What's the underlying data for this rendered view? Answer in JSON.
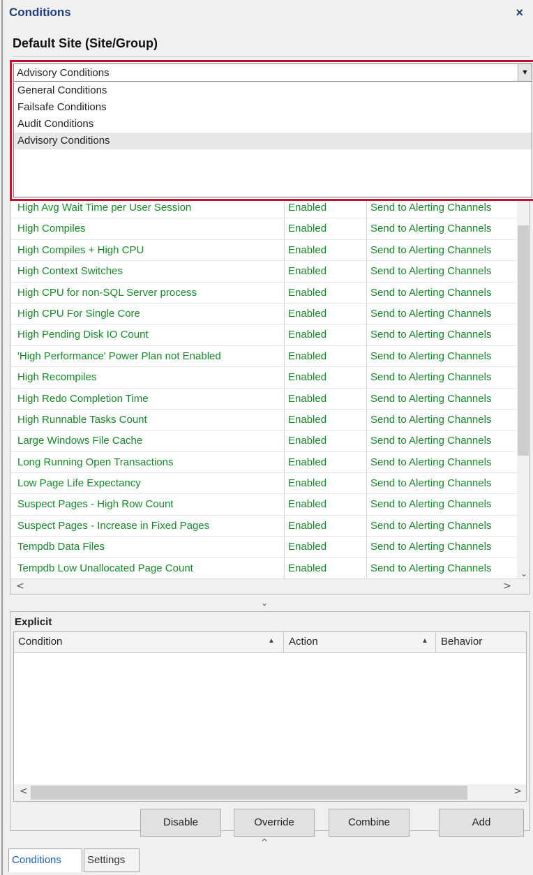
{
  "header": {
    "title": "Conditions",
    "close_glyph": "×",
    "site": "Default Site (Site/Group)"
  },
  "dropdown": {
    "selected": "Advisory Conditions",
    "arrow_glyph": "▼",
    "options": [
      "General Conditions",
      "Failsafe Conditions",
      "Audit Conditions",
      "Advisory Conditions"
    ]
  },
  "conditions": {
    "rows": [
      {
        "name": "High Avg Wait Time per User Session",
        "status": "Enabled",
        "action": "Send to Alerting Channels"
      },
      {
        "name": "High Compiles",
        "status": "Enabled",
        "action": "Send to Alerting Channels"
      },
      {
        "name": "High Compiles + High CPU",
        "status": "Enabled",
        "action": "Send to Alerting Channels"
      },
      {
        "name": "High Context Switches",
        "status": "Enabled",
        "action": "Send to Alerting Channels"
      },
      {
        "name": "High CPU for non-SQL Server process",
        "status": "Enabled",
        "action": "Send to Alerting Channels"
      },
      {
        "name": "High CPU For Single Core",
        "status": "Enabled",
        "action": "Send to Alerting Channels"
      },
      {
        "name": "High Pending Disk IO Count",
        "status": "Enabled",
        "action": "Send to Alerting Channels"
      },
      {
        "name": "'High Performance' Power Plan not Enabled",
        "status": "Enabled",
        "action": "Send to Alerting Channels"
      },
      {
        "name": "High Recompiles",
        "status": "Enabled",
        "action": "Send to Alerting Channels"
      },
      {
        "name": "High Redo Completion Time",
        "status": "Enabled",
        "action": "Send to Alerting Channels"
      },
      {
        "name": "High Runnable Tasks Count",
        "status": "Enabled",
        "action": "Send to Alerting Channels"
      },
      {
        "name": "Large Windows File Cache",
        "status": "Enabled",
        "action": "Send to Alerting Channels"
      },
      {
        "name": "Long Running Open Transactions",
        "status": "Enabled",
        "action": "Send to Alerting Channels"
      },
      {
        "name": "Low Page Life Expectancy",
        "status": "Enabled",
        "action": "Send to Alerting Channels"
      },
      {
        "name": "Suspect Pages - High Row Count",
        "status": "Enabled",
        "action": "Send to Alerting Channels"
      },
      {
        "name": "Suspect Pages - Increase in Fixed Pages",
        "status": "Enabled",
        "action": "Send to Alerting Channels"
      },
      {
        "name": "Tempdb Data Files",
        "status": "Enabled",
        "action": "Send to Alerting Channels"
      },
      {
        "name": "Tempdb Low Unallocated Page Count",
        "status": "Enabled",
        "action": "Send to Alerting Channels"
      }
    ],
    "scroll_left": "<",
    "scroll_right": ">",
    "scroll_down": "⌄"
  },
  "splitter": {
    "down_glyph": "⌄",
    "up_glyph": "^"
  },
  "explicit": {
    "title": "Explicit",
    "columns": [
      "Condition",
      "Action",
      "Behavior"
    ],
    "sort_glyph": "▲",
    "scroll_left": "<",
    "scroll_right": ">",
    "buttons": {
      "disable": "Disable",
      "override": "Override",
      "combine": "Combine",
      "add": "Add"
    }
  },
  "tabs": {
    "conditions": "Conditions",
    "settings": "Settings"
  },
  "colors": {
    "title_blue": "#1f3f7a",
    "row_green": "#17862a",
    "highlight_red": "#c8102e"
  }
}
